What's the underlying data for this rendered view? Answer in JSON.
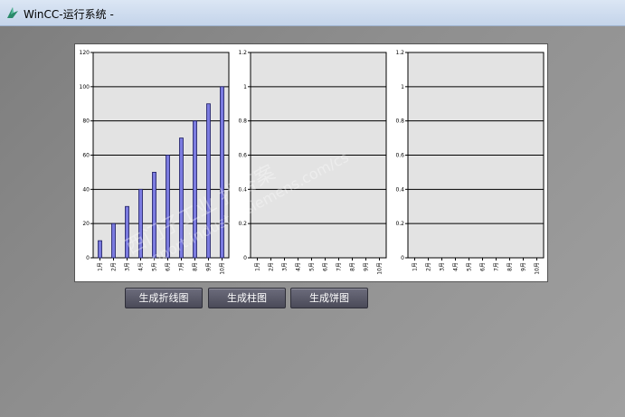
{
  "window": {
    "title": "WinCC-运行系统 -",
    "icon": "wincc-icon"
  },
  "buttons": {
    "line_chart": "生成折线图",
    "bar_chart": "生成柱图",
    "pie_chart": "生成饼图"
  },
  "watermark": {
    "line1": "西门子工业  找答案",
    "line2": "support.industry.siemens.com/cs"
  },
  "chart_data": [
    {
      "type": "bar",
      "categories": [
        "1月",
        "2月",
        "3月",
        "4月",
        "5月",
        "6月",
        "7月",
        "8月",
        "9月",
        "10月"
      ],
      "values": [
        10,
        20,
        30,
        40,
        50,
        60,
        70,
        80,
        90,
        100
      ],
      "yticks": [
        "0",
        "20",
        "40",
        "60",
        "80",
        "100",
        "120"
      ],
      "ylim": [
        0,
        120
      ],
      "grid": true,
      "bar_color": "#7b7be0"
    },
    {
      "type": "bar",
      "categories": [
        "1月",
        "2月",
        "3月",
        "4月",
        "5月",
        "6月",
        "7月",
        "8月",
        "9月",
        "10月"
      ],
      "values": [],
      "yticks": [
        "0",
        "0.2",
        "0.4",
        "0.6",
        "0.8",
        "1",
        "1.2"
      ],
      "ylim": [
        0,
        1.2
      ],
      "grid": true
    },
    {
      "type": "bar",
      "categories": [
        "1月",
        "2月",
        "3月",
        "4月",
        "5月",
        "6月",
        "7月",
        "8月",
        "9月",
        "10月"
      ],
      "values": [],
      "yticks": [
        "0",
        "0.2",
        "0.4",
        "0.6",
        "0.8",
        "1",
        "1.2"
      ],
      "ylim": [
        0,
        1.2
      ],
      "grid": true
    }
  ]
}
